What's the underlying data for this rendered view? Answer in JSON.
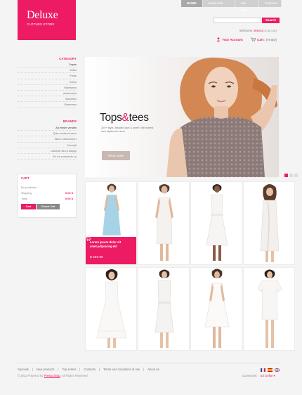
{
  "topnav": [
    {
      "label": "HOME",
      "active": true
    },
    {
      "label": "Bookmark",
      "active": false
    },
    {
      "label": "Site map",
      "active": false
    },
    {
      "label": "Contacts",
      "active": false
    }
  ],
  "logo": {
    "title": "Deluxe",
    "subtitle": "CLOTHES STORE"
  },
  "search": {
    "placeholder": "",
    "button": "Search"
  },
  "welcome": {
    "text": "Welcome",
    "user": "Jessica",
    "logout": "(Log out)"
  },
  "account": {
    "label": "Your Account"
  },
  "cart_top": {
    "label": "Cart:",
    "status": "(empty)"
  },
  "sidebar": {
    "category_title": "CATEGORY",
    "categories": [
      "Capris",
      "Skirts",
      "Pants",
      "Dress",
      "Swimwear",
      "Activewear",
      "Sweaters",
      "Outerwear"
    ],
    "brands_title": "BRANDS",
    "brands": [
      "Ad minim veniam",
      "Quis nostrud exerci",
      "Tation ullamcorper",
      "Suscipit",
      "Lobortis nisl ut aliquip",
      "Ex ea commodo co"
    ]
  },
  "cart_box": {
    "title": "CART",
    "no_products": "No products",
    "shipping_label": "Shipping",
    "shipping_value": "0.00 $",
    "total_label": "Total",
    "total_value": "0.00 $",
    "cart_button": "Cart",
    "checkout_button": "Check Out"
  },
  "banner": {
    "title_a": "Tops",
    "title_amp": "&",
    "title_b": "tees",
    "text": "200+ style. Beaded lace & sheer, the hottest new styles are here!",
    "button": "Shop Now!"
  },
  "products": {
    "featured_name": "Lorem ipsum dolor sit amet,adipiscing elit",
    "featured_price": "$ 269.95"
  },
  "footer": {
    "links": [
      "Specials",
      "New products",
      "Top sellers",
      "Contacts",
      "Terms and conditions of use",
      "About us"
    ],
    "copyright_a": "© 2011 Powered by",
    "copyright_link": "Presta Shop",
    "copyright_b": ". All Rights Reserved",
    "currency_label": "Currencies:",
    "currency_value": "US Dollar"
  },
  "colors": {
    "accent": "#ec1b63",
    "grey_nav": "#cfcfcf"
  }
}
